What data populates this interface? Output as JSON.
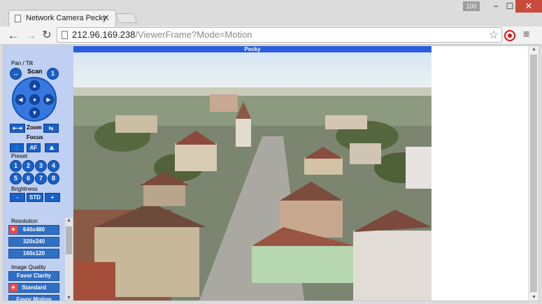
{
  "browser": {
    "tab_title": "Network Camera Pecky",
    "tab_close": "✕",
    "window_badge": "100",
    "minimize": "−",
    "maximize": "☐",
    "close": "✕",
    "url_host": "212.96.169.238",
    "url_path": "/ViewerFrame?Mode=Motion",
    "back": "←",
    "forward": "→",
    "reload": "↻",
    "bookmark": "☆",
    "menu": "≡"
  },
  "camera": {
    "title": "Pecky"
  },
  "sidebar": {
    "pan_tilt_label": "Pan / Tilt",
    "scan_label": "Scan",
    "scan_left": "↔",
    "scan_number": "1",
    "dpad": {
      "up": "▲",
      "down": "▼",
      "left": "◀",
      "right": "▶",
      "home": "●"
    },
    "zoom_label": "Zoom",
    "zoom_out": "⇤⇥",
    "zoom_in": "⇆",
    "focus_label": "Focus",
    "focus_near": "👤",
    "focus_af": "AF",
    "focus_far": "⛰",
    "preset_label": "Preset",
    "presets": [
      "1",
      "2",
      "3",
      "4",
      "5",
      "6",
      "7",
      "8"
    ],
    "brightness_label": "Brightness",
    "brightness_minus": "-",
    "brightness_std": "STD",
    "brightness_plus": "+",
    "resolution_label": "Resolution",
    "resolutions": [
      "640x480",
      "320x240",
      "160x120"
    ],
    "resolution_selected": "640x480",
    "quality_label": "Image Quality",
    "qualities": [
      "Favor Clarity",
      "Standard",
      "Favor Motion"
    ],
    "quality_selected": "Standard"
  },
  "colors": {
    "sidebar_bg": "#bfd0f2",
    "button_blue": "#1a60c8",
    "header_blue": "#2a5ee0",
    "selected_mark": "#e84d4d"
  }
}
